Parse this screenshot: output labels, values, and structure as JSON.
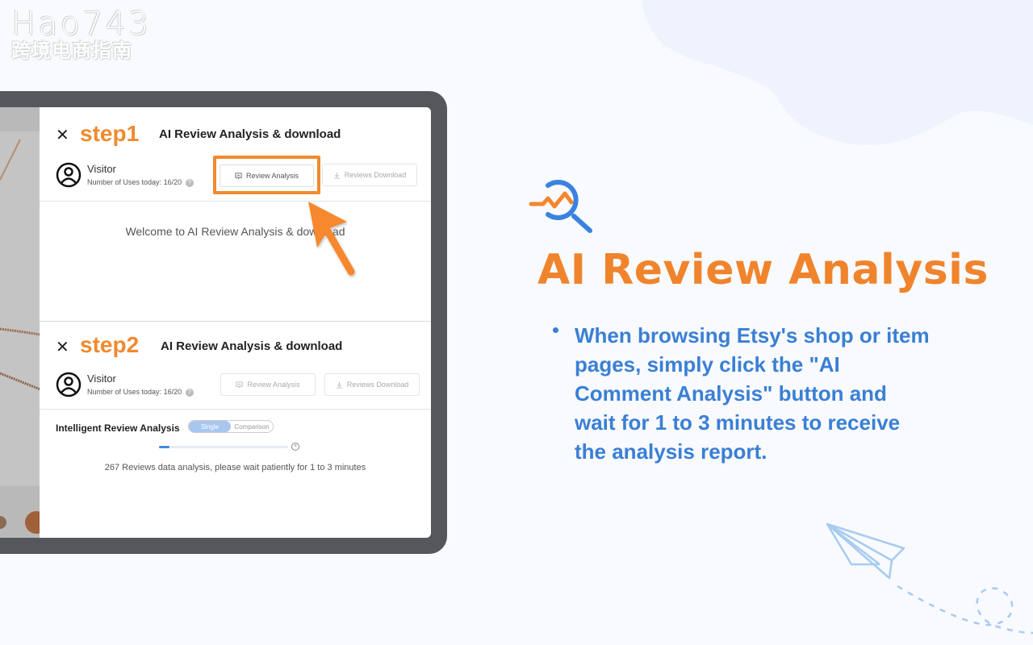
{
  "watermark": {
    "line1": "Hao743",
    "line2": "跨境电商指南"
  },
  "step1": {
    "close_label": "✕",
    "step_label": "step1",
    "title": "AI Review Analysis & download",
    "user_name": "Visitor",
    "uses_label": "Number of Uses today:",
    "uses_value": "16/20",
    "help_icon": "?",
    "review_analysis_button": "Review Analysis",
    "reviews_download_button": "Reviews Download",
    "welcome_text": "Welcome to AI Review Analysis & download"
  },
  "step2": {
    "close_label": "✕",
    "step_label": "step2",
    "title": "AI Review Analysis & download",
    "user_name": "Visitor",
    "uses_label": "Number of Uses today:",
    "uses_value": "16/20",
    "help_icon": "?",
    "review_analysis_button": "Review Analysis",
    "reviews_download_button": "Reviews Download",
    "section_title": "Intelligent Review Analysis",
    "mode_options": [
      "Single",
      "Comparison"
    ],
    "mode_selected": "Single",
    "progress_percent": 8,
    "cancel_icon": "×",
    "wait_text": "267 Reviews data analysis, please wait patiently for 1 to 3 minutes"
  },
  "feature": {
    "title": "AI Review Analysis",
    "description": "When browsing Etsy's shop or item pages, simply click the \"AI Comment Analysis\" button and wait for 1 to 3 minutes to receive the analysis report."
  },
  "colors": {
    "accent_orange": "#f0842c",
    "accent_blue": "#3a7fd5",
    "frame": "#56575c"
  }
}
